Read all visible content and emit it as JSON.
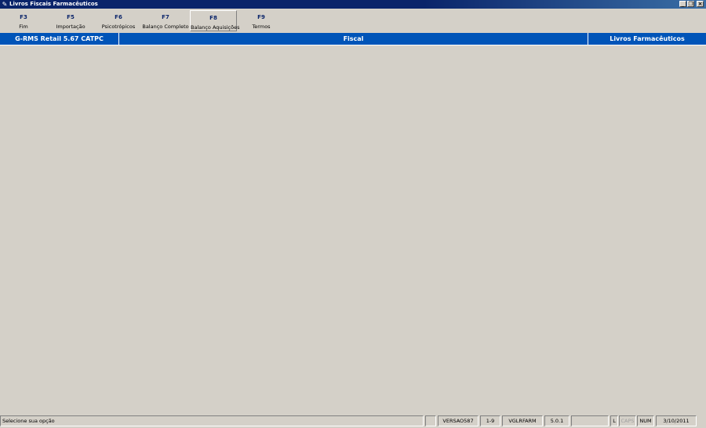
{
  "window": {
    "title": "Livros Fiscais Farmacêuticos",
    "icon": "pen-icon",
    "controls": [
      "minimize-icon",
      "restore-icon",
      "close-icon"
    ]
  },
  "toolbar": {
    "buttons": [
      {
        "key": "F3",
        "label": "Fim"
      },
      {
        "key": "F5",
        "label": "Importação"
      },
      {
        "key": "F6",
        "label": "Psicotrópicos"
      },
      {
        "key": "F7",
        "label": "Balanço Completo"
      },
      {
        "key": "F8",
        "label": "Balanço Aquisições"
      },
      {
        "key": "F9",
        "label": "Termos"
      }
    ]
  },
  "header": {
    "product": "G-RMS Retail 5.67 CATPC",
    "module": "Fiscal",
    "screen": "Livros Farmacêuticos"
  },
  "statusbar": {
    "message": "Selecione sua opção",
    "panels": [
      "",
      "VERSAO587",
      "1-9",
      "VGLRFARM",
      "5.0.1",
      "",
      "L",
      "CAPS",
      "NUM",
      "3/10/2011"
    ]
  },
  "colors": {
    "titlebar": "#0a246a",
    "header_bar": "#0054b8",
    "window_bg": "#d4d0c8",
    "key_text": "#0a246a"
  }
}
